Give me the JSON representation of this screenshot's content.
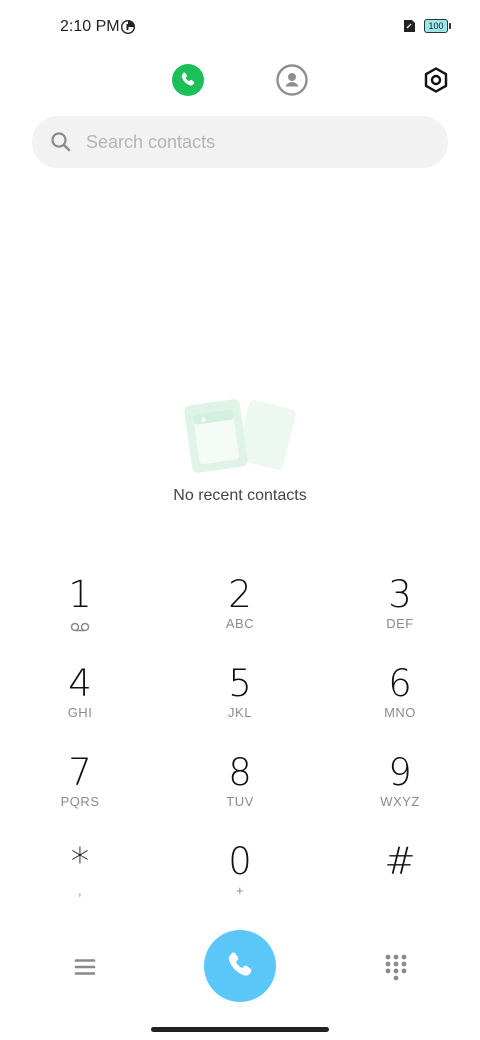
{
  "status_bar": {
    "time": "2:10 PM",
    "battery_level": "100"
  },
  "top_nav": {
    "active_tab": "phone",
    "tabs": [
      {
        "id": "phone",
        "icon": "phone-icon",
        "color": "#1dbf5a"
      },
      {
        "id": "contacts",
        "icon": "contacts-icon"
      }
    ],
    "settings_icon": "settings-icon"
  },
  "search": {
    "placeholder": "Search contacts",
    "value": ""
  },
  "empty_state": {
    "message": "No recent contacts"
  },
  "keypad": {
    "keys": [
      {
        "digit": "1",
        "letters": ""
      },
      {
        "digit": "2",
        "letters": "ABC"
      },
      {
        "digit": "3",
        "letters": "DEF"
      },
      {
        "digit": "4",
        "letters": "GHI"
      },
      {
        "digit": "5",
        "letters": "JKL"
      },
      {
        "digit": "6",
        "letters": "MNO"
      },
      {
        "digit": "7",
        "letters": "PQRS"
      },
      {
        "digit": "8",
        "letters": "TUV"
      },
      {
        "digit": "9",
        "letters": "WXYZ"
      },
      {
        "digit": "*",
        "letters": ","
      },
      {
        "digit": "0",
        "letters": "+"
      },
      {
        "digit": "#",
        "letters": ""
      }
    ]
  },
  "bottom_bar": {
    "call_button_color": "#5bc6f8"
  }
}
